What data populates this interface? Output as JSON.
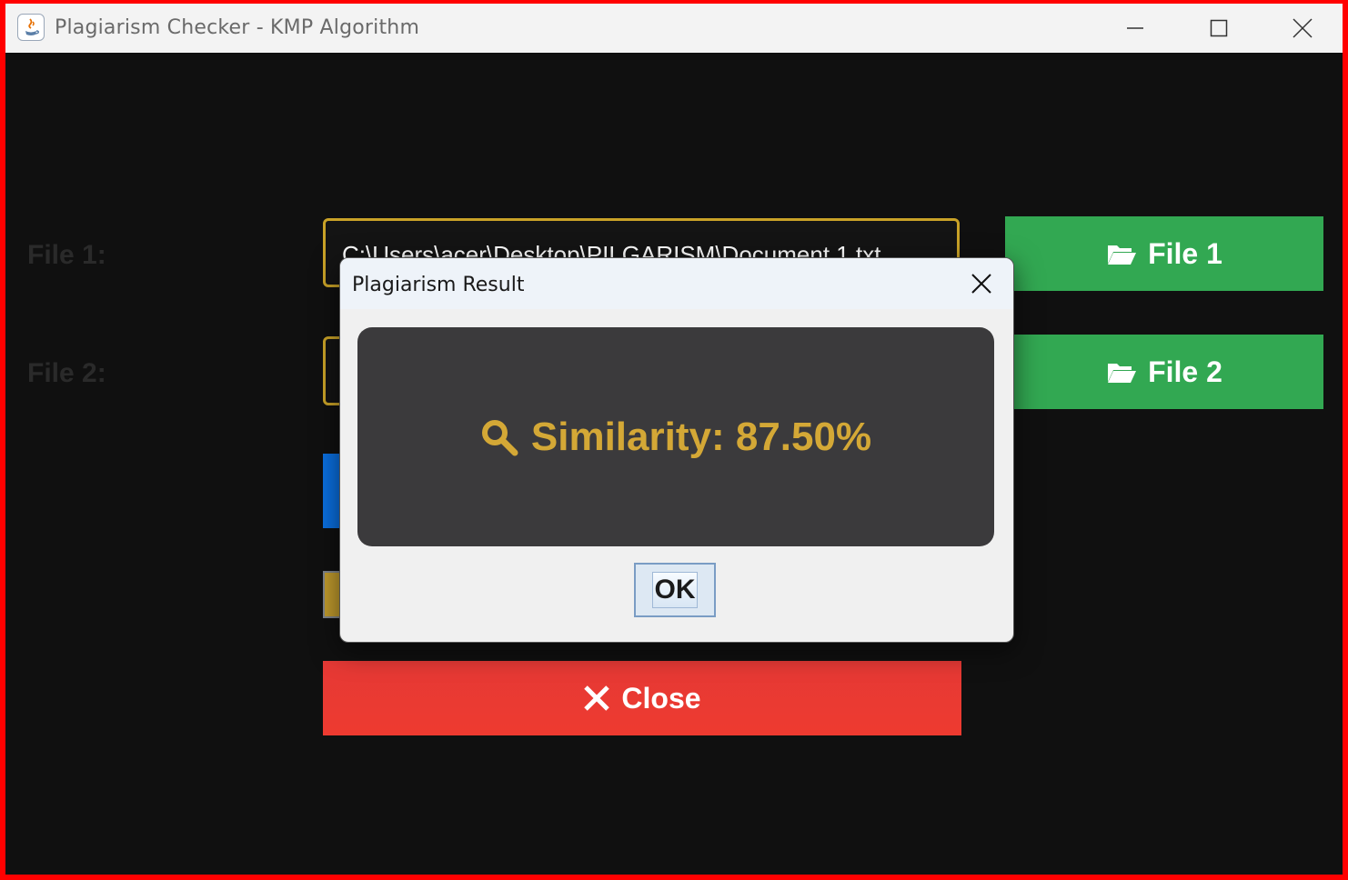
{
  "window": {
    "title": "Plagiarism Checker - KMP Algorithm"
  },
  "form": {
    "file1_label": "File 1:",
    "file2_label": "File 2:",
    "file1_path": "C:\\Users\\acer\\Desktop\\PILGARISM\\Document 1.txt",
    "file1_button": "File 1",
    "file2_button": "File 2",
    "close_button": "Close"
  },
  "dialog": {
    "title": "Plagiarism Result",
    "result_text": "Similarity: 87.50%",
    "ok_label": "OK"
  },
  "colors": {
    "accent_gold": "#d4a836",
    "button_green": "#32a852",
    "button_red": "#e53935",
    "button_blue": "#0a6fe0",
    "background": "#101010"
  },
  "icons": {
    "app": "java-icon",
    "file_buttons": "folder-open-icon",
    "result": "search-icon",
    "close": "x-icon"
  }
}
